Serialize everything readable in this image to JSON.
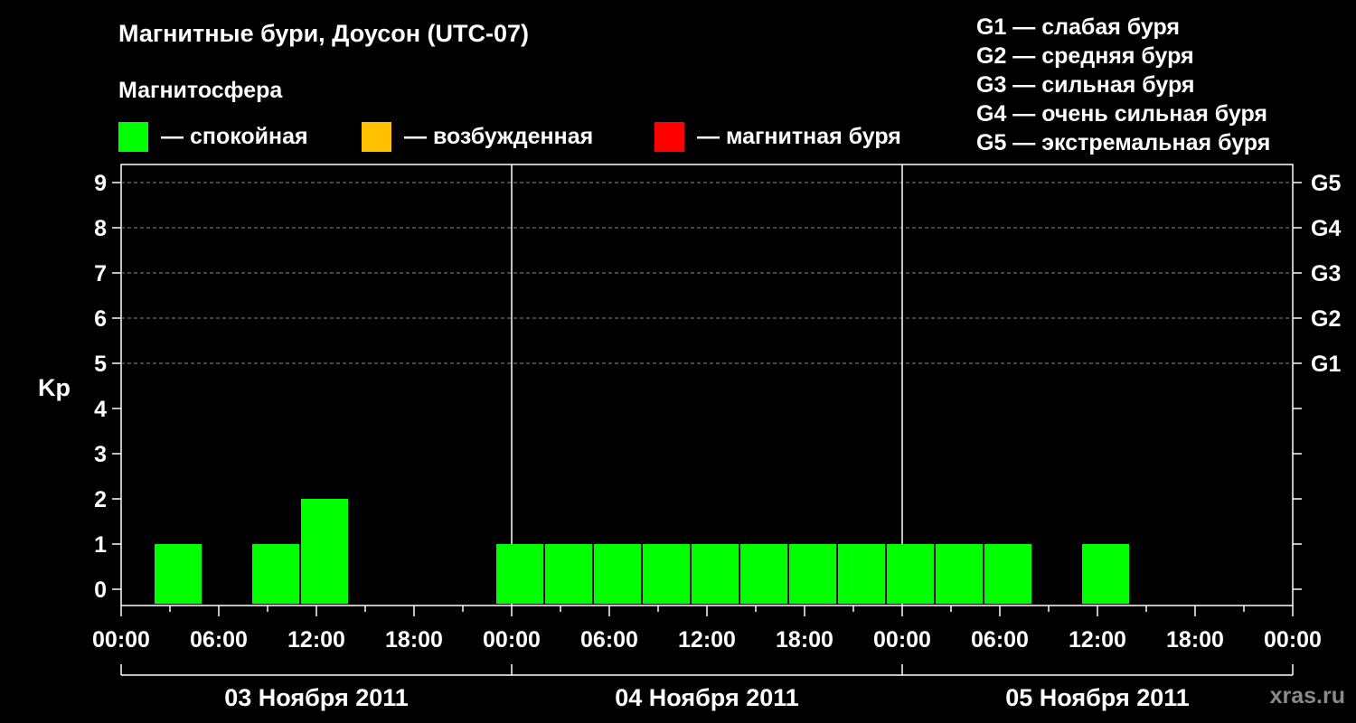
{
  "title": "Магнитные бури, Доусон (UTC-07)",
  "magnetosphere": {
    "heading": "Магнитосфера",
    "states": [
      {
        "label": "— спокойная",
        "color": "#00ff00"
      },
      {
        "label": "— возбужденная",
        "color": "#ffc000"
      },
      {
        "label": "— магнитная буря",
        "color": "#ff0000"
      }
    ]
  },
  "g_legend": [
    "G1 — слабая буря",
    "G2 — средняя буря",
    "G3 — сильная буря",
    "G4 — очень сильная буря",
    "G5 — экстремальная буря"
  ],
  "watermark": "xras.ru",
  "chart_data": {
    "type": "bar",
    "ylabel": "Kp",
    "ylim": [
      0,
      9
    ],
    "yticks": [
      "0",
      "1",
      "2",
      "3",
      "4",
      "5",
      "6",
      "7",
      "8",
      "9"
    ],
    "g_scale": [
      {
        "kp": 5,
        "label": "G1"
      },
      {
        "kp": 6,
        "label": "G2"
      },
      {
        "kp": 7,
        "label": "G3"
      },
      {
        "kp": 8,
        "label": "G4"
      },
      {
        "kp": 9,
        "label": "G5"
      }
    ],
    "xlim_hours": [
      0,
      72
    ],
    "xticks": [
      {
        "hour": 0,
        "label": "00:00"
      },
      {
        "hour": 6,
        "label": "06:00"
      },
      {
        "hour": 12,
        "label": "12:00"
      },
      {
        "hour": 18,
        "label": "18:00"
      },
      {
        "hour": 24,
        "label": "00:00"
      },
      {
        "hour": 30,
        "label": "06:00"
      },
      {
        "hour": 36,
        "label": "12:00"
      },
      {
        "hour": 42,
        "label": "18:00"
      },
      {
        "hour": 48,
        "label": "00:00"
      },
      {
        "hour": 54,
        "label": "06:00"
      },
      {
        "hour": 60,
        "label": "12:00"
      },
      {
        "hour": 66,
        "label": "18:00"
      },
      {
        "hour": 72,
        "label": "00:00"
      }
    ],
    "days": [
      {
        "label": "03 Ноября 2011",
        "start": 0,
        "end": 24
      },
      {
        "label": "04 Ноября 2011",
        "start": 24,
        "end": 48
      },
      {
        "label": "05 Ноября 2011",
        "start": 48,
        "end": 72
      }
    ],
    "bar_width_hours": 3,
    "bars": [
      {
        "start": 2,
        "kp": 1,
        "color": "#00ff00"
      },
      {
        "start": 8,
        "kp": 1,
        "color": "#00ff00"
      },
      {
        "start": 11,
        "kp": 2,
        "color": "#00ff00"
      },
      {
        "start": 23,
        "kp": 1,
        "color": "#00ff00"
      },
      {
        "start": 26,
        "kp": 1,
        "color": "#00ff00"
      },
      {
        "start": 29,
        "kp": 1,
        "color": "#00ff00"
      },
      {
        "start": 32,
        "kp": 1,
        "color": "#00ff00"
      },
      {
        "start": 35,
        "kp": 1,
        "color": "#00ff00"
      },
      {
        "start": 38,
        "kp": 1,
        "color": "#00ff00"
      },
      {
        "start": 41,
        "kp": 1,
        "color": "#00ff00"
      },
      {
        "start": 44,
        "kp": 1,
        "color": "#00ff00"
      },
      {
        "start": 47,
        "kp": 1,
        "color": "#00ff00"
      },
      {
        "start": 50,
        "kp": 1,
        "color": "#00ff00"
      },
      {
        "start": 53,
        "kp": 1,
        "color": "#00ff00"
      },
      {
        "start": 59,
        "kp": 1,
        "color": "#00ff00"
      }
    ]
  }
}
